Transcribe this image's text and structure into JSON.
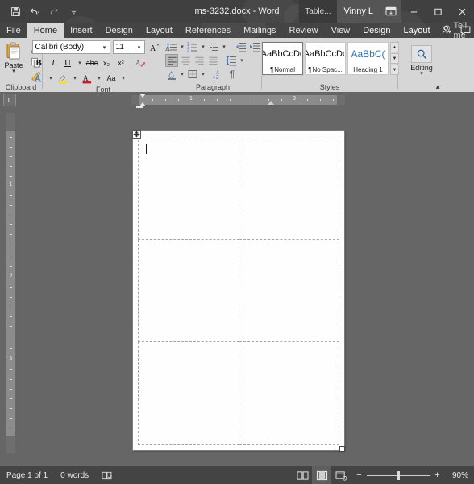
{
  "titlebar": {
    "document_title": "ms-3232.docx - Word",
    "quick_access": [
      {
        "name": "save",
        "icon": "save-icon"
      },
      {
        "name": "undo",
        "icon": "undo-icon"
      },
      {
        "name": "redo",
        "icon": "redo-icon"
      },
      {
        "name": "customize-qat",
        "icon": "chevron-down-icon"
      }
    ],
    "contextual_tab_mini": "Table...",
    "account_name": "Vinny L",
    "ribbon_display_options": "ribbon-options-icon",
    "minimize": "–",
    "restore": "▢",
    "close": "✕"
  },
  "tabs": [
    {
      "label": "File",
      "active": false,
      "contextual": false
    },
    {
      "label": "Home",
      "active": true,
      "contextual": false
    },
    {
      "label": "Insert",
      "active": false,
      "contextual": false
    },
    {
      "label": "Design",
      "active": false,
      "contextual": false
    },
    {
      "label": "Layout",
      "active": false,
      "contextual": false
    },
    {
      "label": "References",
      "active": false,
      "contextual": false
    },
    {
      "label": "Mailings",
      "active": false,
      "contextual": false
    },
    {
      "label": "Review",
      "active": false,
      "contextual": false
    },
    {
      "label": "View",
      "active": false,
      "contextual": false
    },
    {
      "label": "Design",
      "active": false,
      "contextual": true
    },
    {
      "label": "Layout",
      "active": false,
      "contextual": true
    }
  ],
  "tell_me": {
    "placeholder": "Tell me",
    "icon": "lightbulb-icon"
  },
  "titlebar_icons": {
    "share": "share-person-icon",
    "comments": "comment-icon"
  },
  "ribbon": {
    "groups": [
      {
        "name": "Clipboard",
        "label": "Clipboard",
        "paste_label": "Paste",
        "buttons": [
          {
            "name": "cut",
            "label": "Cut",
            "icon": "scissors-icon"
          },
          {
            "name": "copy",
            "label": "Copy",
            "icon": "copy-icon"
          },
          {
            "name": "format-painter",
            "label": "Format Painter",
            "icon": "paintbrush-icon"
          }
        ],
        "dialog_launcher": true
      },
      {
        "name": "Font",
        "label": "Font",
        "font_name": "Calibri (Body)",
        "font_size": "11",
        "buttons": [
          {
            "name": "bold",
            "label": "B"
          },
          {
            "name": "italic",
            "label": "I"
          },
          {
            "name": "underline",
            "label": "U"
          },
          {
            "name": "strikethrough",
            "label": "abc"
          },
          {
            "name": "subscript",
            "label": "x₂"
          },
          {
            "name": "superscript",
            "label": "x²"
          },
          {
            "name": "clear-formatting",
            "label": "Clear All Formatting"
          },
          {
            "name": "text-effects",
            "label": "A"
          },
          {
            "name": "text-highlight-color",
            "label": "Text Highlight Color"
          },
          {
            "name": "font-color",
            "label": "A"
          },
          {
            "name": "change-case",
            "label": "Aa"
          },
          {
            "name": "grow-font",
            "label": "A"
          },
          {
            "name": "shrink-font",
            "label": "A"
          }
        ],
        "dialog_launcher": true
      },
      {
        "name": "Paragraph",
        "label": "Paragraph",
        "buttons": [
          {
            "name": "bullets",
            "label": "Bullets"
          },
          {
            "name": "numbering",
            "label": "Numbering"
          },
          {
            "name": "multilevel-list",
            "label": "Multilevel List"
          },
          {
            "name": "decrease-indent",
            "label": "Decrease Indent"
          },
          {
            "name": "increase-indent",
            "label": "Increase Indent"
          },
          {
            "name": "align-left",
            "label": "Align Left",
            "active": true
          },
          {
            "name": "align-center",
            "label": "Center"
          },
          {
            "name": "align-right",
            "label": "Align Right"
          },
          {
            "name": "justify",
            "label": "Justify"
          },
          {
            "name": "line-spacing",
            "label": "Line and Paragraph Spacing"
          },
          {
            "name": "shading",
            "label": "Shading"
          },
          {
            "name": "borders",
            "label": "Borders"
          },
          {
            "name": "sort",
            "label": "Sort"
          },
          {
            "name": "show-formatting-marks",
            "label": "¶"
          }
        ],
        "dialog_launcher": true
      },
      {
        "name": "Styles",
        "label": "Styles",
        "items": [
          {
            "preview": "AaBbCcDc",
            "name": "Normal",
            "marker": "¶",
            "selected": true,
            "heading": false
          },
          {
            "preview": "AaBbCcDc",
            "name": "No Spac...",
            "marker": "¶",
            "selected": false,
            "heading": false
          },
          {
            "preview": "AaBbC(",
            "name": "Heading 1",
            "marker": "",
            "selected": false,
            "heading": true
          }
        ],
        "dialog_launcher": true
      },
      {
        "name": "Editing",
        "label": "Editing",
        "button_label": "Editing",
        "icon": "magnifier-icon"
      }
    ],
    "collapse_ribbon": "collapse-ribbon-icon"
  },
  "ruler": {
    "tab_selector_glyph": "L",
    "horizontal_numbers": [
      "1",
      "3"
    ],
    "unit_span_inches": 4,
    "vertical_numbers": [
      "1",
      "2",
      "3"
    ]
  },
  "document": {
    "page_label": "page-1",
    "table": {
      "rows": 3,
      "columns": 2,
      "cells": [
        [
          "",
          ""
        ],
        [
          "",
          ""
        ],
        [
          "",
          ""
        ]
      ],
      "gridlines": "dashed"
    },
    "caret_visible": true,
    "table_move_handle": "table-move-handle",
    "table_resize_handle": "table-resize-handle"
  },
  "statusbar": {
    "page_status": "Page 1 of 1",
    "word_count": "0 words",
    "proofing_icon": "proofing-errors-icon",
    "views": [
      {
        "name": "read-mode",
        "label": "Read Mode",
        "active": false
      },
      {
        "name": "print-layout",
        "label": "Print Layout",
        "active": true
      },
      {
        "name": "web-layout",
        "label": "Web Layout",
        "active": false
      }
    ],
    "zoom_out": "−",
    "zoom_in": "+",
    "zoom_level": "90%",
    "zoom_value": 90
  },
  "colors": {
    "titlebar": "#404040",
    "tabbar": "#444444",
    "ribbon": "#d6d6d6",
    "active_tab_bg": "#d6d6d6",
    "workspace": "#666666",
    "page": "#fefefe",
    "statusbar": "#444444",
    "heading_blue": "#2e74b5",
    "accent": "#2b579a"
  }
}
